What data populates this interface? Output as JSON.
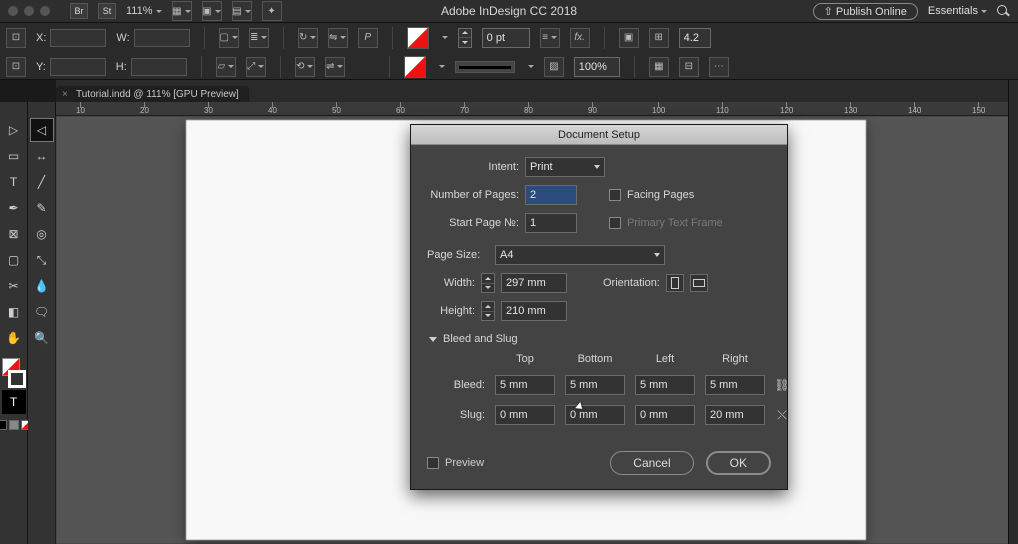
{
  "app": {
    "title": "Adobe InDesign CC 2018",
    "publish": "⇧ Publish Online",
    "workspace": "Essentials",
    "bridge_icon": "Br",
    "stock_icon": "St",
    "zoom": "111%"
  },
  "tab": {
    "label": "Tutorial.indd @ 111% [GPU Preview]"
  },
  "ruler": {
    "ticks": [
      "10",
      "20",
      "30",
      "40",
      "50",
      "60",
      "70",
      "80",
      "90",
      "100",
      "110",
      "120",
      "130",
      "140",
      "150"
    ]
  },
  "options": {
    "x": "X:",
    "y": "Y:",
    "w": "W:",
    "h": "H:",
    "x_val": "",
    "y_val": "",
    "w_val": "",
    "h_val": "",
    "stroke_label": "0 pt",
    "scale": "100%",
    "num": "4.2"
  },
  "dialog": {
    "title": "Document Setup",
    "intent_label": "Intent:",
    "intent_value": "Print",
    "pages_label": "Number of Pages:",
    "pages_value": "2",
    "start_label": "Start Page №:",
    "start_value": "1",
    "facing_label": "Facing Pages",
    "ptf_label": "Primary Text Frame",
    "page_size_label": "Page Size:",
    "page_size_value": "A4",
    "width_label": "Width:",
    "width_value": "297 mm",
    "height_label": "Height:",
    "height_value": "210 mm",
    "orientation_label": "Orientation:",
    "bleed_section": "Bleed and Slug",
    "col_top": "Top",
    "col_bottom": "Bottom",
    "col_left": "Left",
    "col_right": "Right",
    "bleed_label": "Bleed:",
    "slug_label": "Slug:",
    "bleed": {
      "top": "5 mm",
      "bottom": "5 mm",
      "left": "5 mm",
      "right": "5 mm"
    },
    "slug": {
      "top": "0 mm",
      "bottom": "0 mm",
      "left": "0 mm",
      "right": "20 mm"
    },
    "preview_label": "Preview",
    "cancel": "Cancel",
    "ok": "OK"
  }
}
